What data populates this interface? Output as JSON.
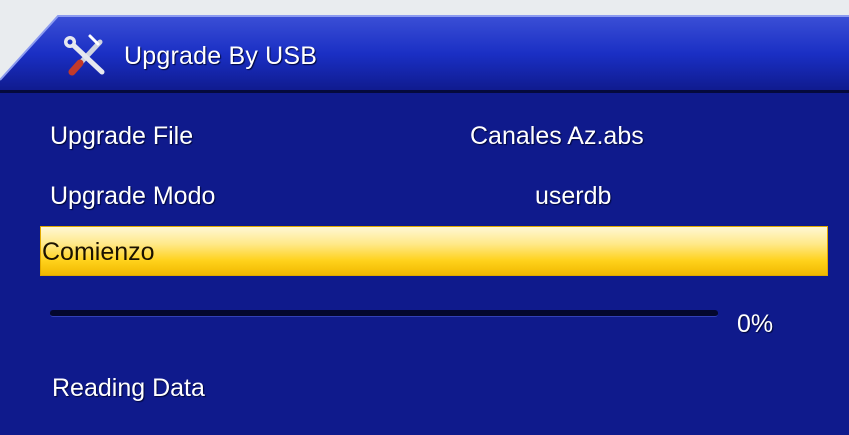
{
  "header": {
    "title": "Upgrade By USB",
    "icon": "tools-icon"
  },
  "rows": [
    {
      "label": "Upgrade File",
      "value": "Canales Az.abs"
    },
    {
      "label": "Upgrade Modo",
      "value": "userdb"
    }
  ],
  "action": {
    "label": "Comienzo"
  },
  "progress": {
    "percent_text": "0%",
    "fraction": 0
  },
  "status": {
    "text": "Reading Data"
  },
  "colors": {
    "panel": "#0f1a8c",
    "header": "#1a2fc4",
    "highlight": "#ffd21c",
    "text": "#ffffff"
  }
}
